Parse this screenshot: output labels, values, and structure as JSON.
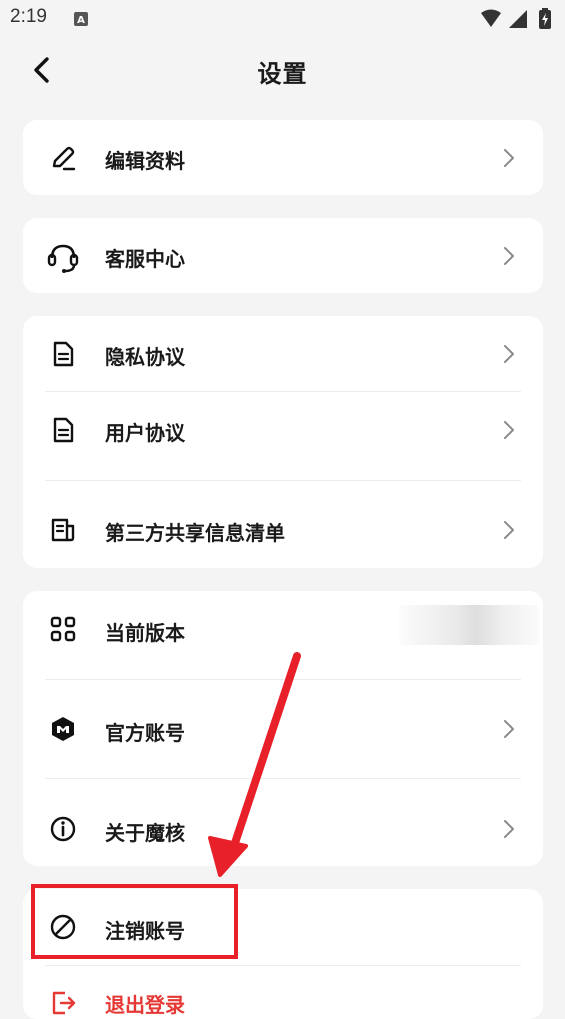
{
  "status_bar": {
    "time": "2:19"
  },
  "header": {
    "title": "设置"
  },
  "groups": {
    "profile": {
      "edit_profile": "编辑资料"
    },
    "service": {
      "customer_service": "客服中心"
    },
    "agreements": {
      "privacy": "隐私协议",
      "user_agreement": "用户协议",
      "third_party": "第三方共享信息清单"
    },
    "about": {
      "version": "当前版本",
      "official_account": "官方账号",
      "about_app": "关于魔核"
    },
    "account": {
      "cancel_account": "注销账号",
      "logout": "退出登录"
    }
  },
  "colors": {
    "background": "#f4f4f4",
    "card": "#ffffff",
    "annotation": "#e8202a",
    "logout": "#e53935"
  },
  "icons": {
    "edit_profile": "pencil-icon",
    "customer_service": "headset-icon",
    "privacy": "document-icon",
    "user_agreement": "document-icon",
    "third_party": "list-document-icon",
    "version": "grid-icon",
    "official_account": "cube-icon",
    "about_app": "info-icon",
    "cancel_account": "prohibited-icon",
    "logout": "logout-icon"
  }
}
